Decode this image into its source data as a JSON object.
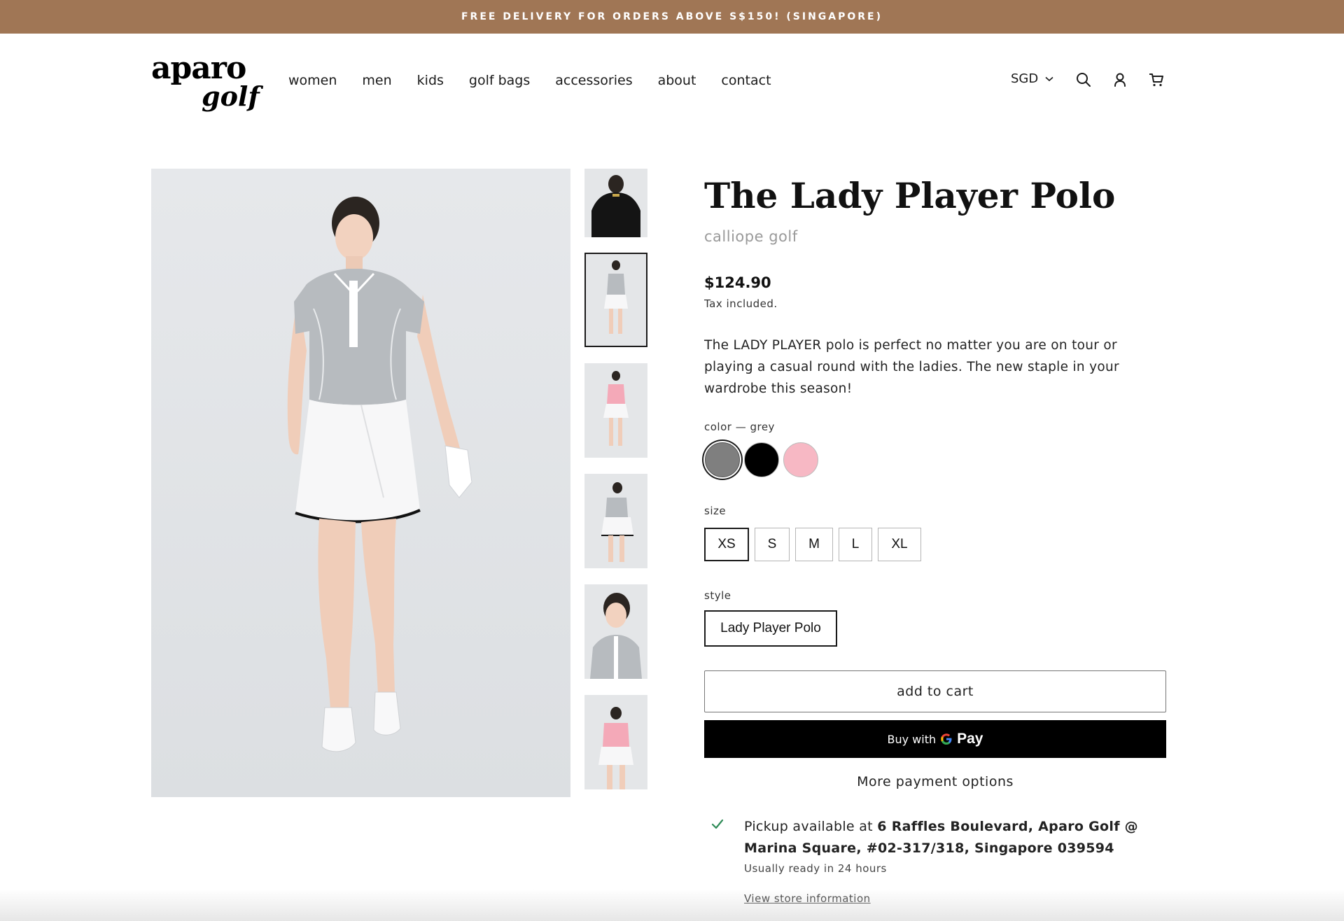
{
  "announcement": "FREE DELIVERY FOR ORDERS ABOVE S$150! (SINGAPORE)",
  "brand": {
    "line1": "aparo",
    "line2": "golf"
  },
  "nav": [
    "women",
    "men",
    "kids",
    "golf bags",
    "accessories",
    "about",
    "contact"
  ],
  "header": {
    "currency": "SGD",
    "icons": [
      "search-icon",
      "account-icon",
      "cart-icon"
    ]
  },
  "product": {
    "title": "The Lady Player Polo",
    "vendor": "calliope golf",
    "price": "$124.90",
    "tax_note": "Tax included.",
    "description": "The LADY PLAYER polo is perfect no matter you are on tour or playing a casual round with the ladies. The new staple in your wardrobe this season!",
    "color_label": "color — grey",
    "colors": [
      {
        "name": "grey",
        "hex": "#7f7f7f",
        "selected": true
      },
      {
        "name": "black",
        "hex": "#000000",
        "selected": false
      },
      {
        "name": "pink",
        "hex": "#f7b8c4",
        "selected": false
      }
    ],
    "size_label": "size",
    "sizes": [
      "XS",
      "S",
      "M",
      "L",
      "XL"
    ],
    "selected_size": "XS",
    "style_label": "style",
    "styles": [
      "Lady Player Polo"
    ],
    "add_to_cart": "add to cart",
    "gpay_prefix": "Buy with",
    "gpay_brand": "Pay",
    "more_payment": "More payment options"
  },
  "pickup": {
    "prefix": "Pickup available at ",
    "location": "6 Raffles Boulevard, Aparo Golf @ Marina Square, #02-317/318, Singapore 039594",
    "ready": "Usually ready in 24 hours",
    "link": "View store information"
  },
  "thumbnails": [
    {
      "shirt": "black",
      "view": "back",
      "selected": false
    },
    {
      "shirt": "grey",
      "view": "full",
      "selected": true
    },
    {
      "shirt": "pink",
      "view": "full",
      "selected": false
    },
    {
      "shirt": "grey",
      "view": "full",
      "selected": false
    },
    {
      "shirt": "grey",
      "view": "portrait",
      "selected": false
    },
    {
      "shirt": "pink",
      "view": "full",
      "selected": false
    }
  ],
  "colors": {
    "announce_bg": "#a07655",
    "text": "#1a1a1a",
    "muted": "#9a9a9a",
    "check_green": "#2e8b57",
    "gpay_bg": "#000000"
  }
}
